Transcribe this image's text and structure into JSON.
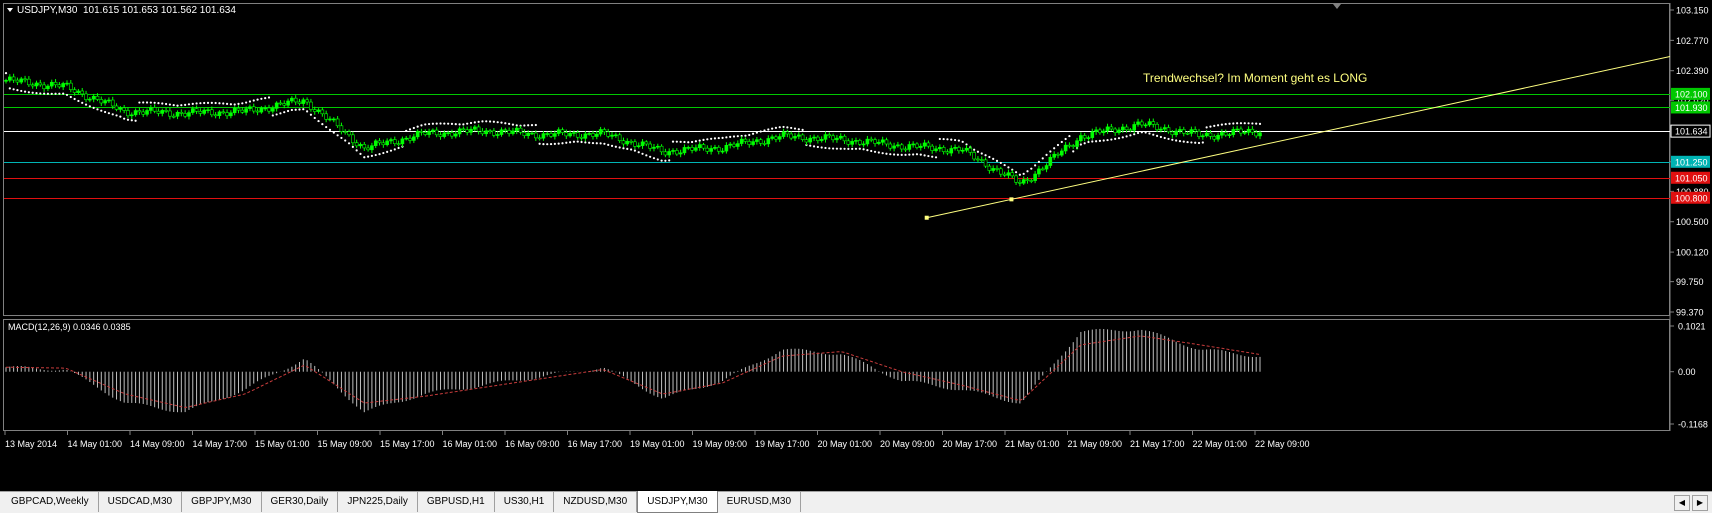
{
  "main_header": {
    "symbol": "USDJPY,M30",
    "ohlc": "101.615 101.653 101.562 101.634"
  },
  "annotation": "Trendwechsel? Im Moment geht es LONG",
  "price_axis_ticks": [
    "103.150",
    "102.770",
    "102.390",
    "102.020",
    "101.634",
    "101.250",
    "100.880",
    "100.500",
    "100.120",
    "99.750",
    "99.370"
  ],
  "price_level_labels": [
    {
      "text": "102.100",
      "price": 102.1,
      "color": "#00c800"
    },
    {
      "text": "101.930",
      "price": 101.93,
      "color": "#00c800"
    },
    {
      "text": "101.634",
      "price": 101.634,
      "color": "#ffffff"
    },
    {
      "text": "101.250",
      "price": 101.25,
      "color": "#00b4b4"
    },
    {
      "text": "101.050",
      "price": 101.05,
      "color": "#e01010"
    },
    {
      "text": "100.800",
      "price": 100.8,
      "color": "#e01010"
    }
  ],
  "macd_header": "MACD(12,26,9) 0.0346 0.0385",
  "macd_axis_ticks": [
    "0.1021",
    "0.00",
    "-0.1168"
  ],
  "time_axis_labels": [
    "13 May 2014",
    "14 May 01:00",
    "14 May 09:00",
    "14 May 17:00",
    "15 May 01:00",
    "15 May 09:00",
    "15 May 17:00",
    "16 May 01:00",
    "16 May 09:00",
    "16 May 17:00",
    "19 May 01:00",
    "19 May 09:00",
    "19 May 17:00",
    "20 May 01:00",
    "20 May 09:00",
    "20 May 17:00",
    "21 May 01:00",
    "21 May 09:00",
    "21 May 17:00",
    "22 May 01:00",
    "22 May 09:00"
  ],
  "tabs": [
    {
      "label": "GBPCAD,Weekly",
      "active": false
    },
    {
      "label": "USDCAD,M30",
      "active": false
    },
    {
      "label": "GBPJPY,M30",
      "active": false
    },
    {
      "label": "GER30,Daily",
      "active": false
    },
    {
      "label": "JPN225,Daily",
      "active": false
    },
    {
      "label": "GBPUSD,H1",
      "active": false
    },
    {
      "label": "US30,H1",
      "active": false
    },
    {
      "label": "NZDUSD,M30",
      "active": false
    },
    {
      "label": "USDJPY,M30",
      "active": true
    },
    {
      "label": "EURUSD,M30",
      "active": false
    }
  ],
  "colors": {
    "background": "#000000",
    "bull_candle": "#00ff00",
    "bear_candle": "#000000",
    "sar_dots": "#ffffff",
    "trendline": "#ffff80",
    "annotation": "#ffff80",
    "macd_hist": "#c0c0c0",
    "macd_signal": "#c83c3c",
    "support_line": "#e01010",
    "resistance_line": "#00c800",
    "current_line": "#c0c0c0"
  },
  "chart_data": [
    {
      "type": "candlestick",
      "ylim": [
        99.37,
        103.15
      ],
      "x": [
        "13 May 2014",
        "14 May 01:00",
        "14 May 09:00",
        "14 May 17:00",
        "15 May 01:00",
        "15 May 09:00",
        "15 May 17:00",
        "16 May 01:00",
        "16 May 09:00",
        "16 May 17:00",
        "19 May 01:00",
        "19 May 09:00",
        "19 May 17:00",
        "20 May 01:00",
        "20 May 09:00",
        "20 May 17:00",
        "21 May 01:00",
        "21 May 09:00",
        "21 May 17:00",
        "22 May 01:00",
        "22 May 09:00",
        "22 May 13:00"
      ],
      "close_path": [
        102.27,
        102.19,
        101.88,
        101.86,
        101.88,
        102.02,
        101.42,
        101.6,
        101.64,
        101.59,
        101.6,
        101.38,
        101.43,
        101.57,
        101.53,
        101.45,
        101.4,
        100.97,
        101.57,
        101.72,
        101.58,
        101.634
      ],
      "horizontal_levels": [
        102.1,
        101.93,
        101.634,
        101.25,
        101.05,
        100.8
      ],
      "trendline": {
        "from": {
          "x": "20 May 17:00",
          "price": 100.55
        },
        "through": {
          "x": "21 May 01:00",
          "price": 100.78
        },
        "extends_to_right_edge": true
      }
    },
    {
      "type": "bar",
      "name": "MACD(12,26,9)",
      "ylim": [
        -0.1168,
        0.1021
      ],
      "values": [
        0.01,
        0.005,
        -0.07,
        -0.09,
        -0.04,
        0.03,
        -0.09,
        -0.05,
        -0.03,
        -0.01,
        0.01,
        -0.06,
        -0.02,
        0.05,
        0.04,
        -0.02,
        -0.04,
        -0.07,
        0.09,
        0.095,
        0.05,
        0.0346
      ],
      "signal": [
        0.01,
        0.008,
        -0.05,
        -0.08,
        -0.05,
        0.015,
        -0.07,
        -0.055,
        -0.035,
        -0.015,
        0.005,
        -0.05,
        -0.025,
        0.035,
        0.045,
        0.0,
        -0.03,
        -0.065,
        0.06,
        0.08,
        0.06,
        0.0385
      ]
    }
  ]
}
